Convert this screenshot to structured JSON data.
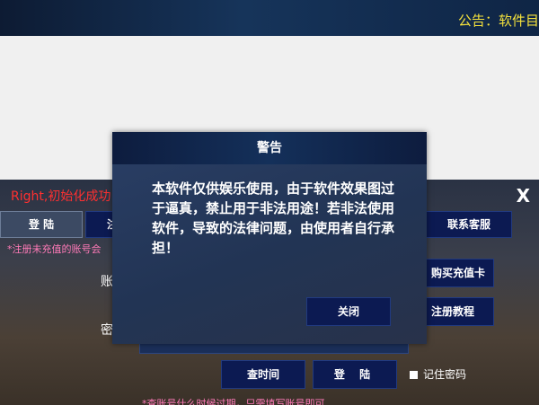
{
  "topbar": {
    "announcement": "公告：软件目"
  },
  "app": {
    "status_text": "Right,初始化成功",
    "close_glyph": "X",
    "tabs": {
      "login": "登 陆",
      "register": "注"
    },
    "note_register": "*注册未充值的账号会",
    "labels": {
      "account": "账",
      "password": "密"
    },
    "buttons": {
      "support": "联系客服",
      "buy_card": "购买充值卡",
      "tutorial": "注册教程",
      "check_time": "查时间",
      "login": "登 陆"
    },
    "remember_label": "记住密码",
    "note_time": "*查账号什么时候过期，只需填写账号即可"
  },
  "modal": {
    "title": "警告",
    "message": "本软件仅供娱乐使用，由于软件效果图过于逼真，禁止用于非法用途！若非法使用软件，导致的法律问题，由使用者自行承担！",
    "close_label": "关闭"
  }
}
